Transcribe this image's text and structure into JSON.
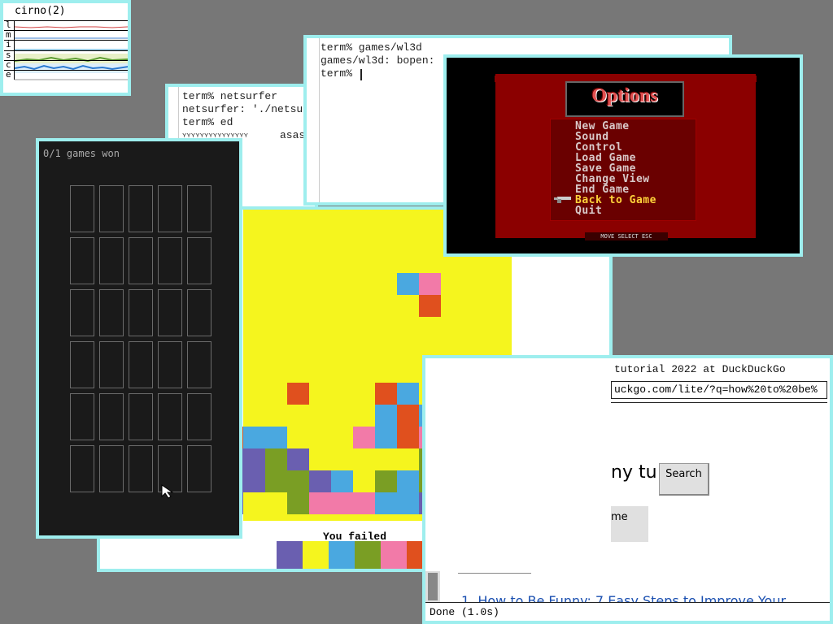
{
  "stats": {
    "title": "cirno(2)",
    "rows": [
      "l",
      "m",
      "i",
      "s",
      "c",
      "e"
    ]
  },
  "term_netsurfer": {
    "lines": [
      "term% netsurfer",
      "netsurfer: './netsu",
      "term% ed",
      "asas"
    ]
  },
  "term_wl3d": {
    "lines": [
      "term% games/wl3d",
      "games/wl3d: bopen:",
      "term% "
    ]
  },
  "cards": {
    "title": "0/1 games won"
  },
  "tetris": {
    "status": "You failed",
    "palette_colors": [
      "#6a5fb0",
      "#f5f51e",
      "#4aa8e0",
      "#7a9e24",
      "#f27aa8",
      "#e0501e"
    ]
  },
  "options": {
    "title": "Options",
    "items": [
      "New Game",
      "Sound",
      "Control",
      "Load Game",
      "Save Game",
      "Change View",
      "End Game",
      "Back to Game",
      "Quit"
    ],
    "selected_item": "Back to Game",
    "footer": "MOVE  SELECT  ESC"
  },
  "browser": {
    "title": "tutorial 2022 at DuckDuckGo",
    "url": "uckgo.com/lite/?q=how%20to%20be%",
    "search_value": "ny tu",
    "search_button": "Search",
    "home_button": "me",
    "result_text": "1.   How to Be Funny: 7 Easy Steps to Improve Your",
    "status": "Done (1.0s)"
  }
}
